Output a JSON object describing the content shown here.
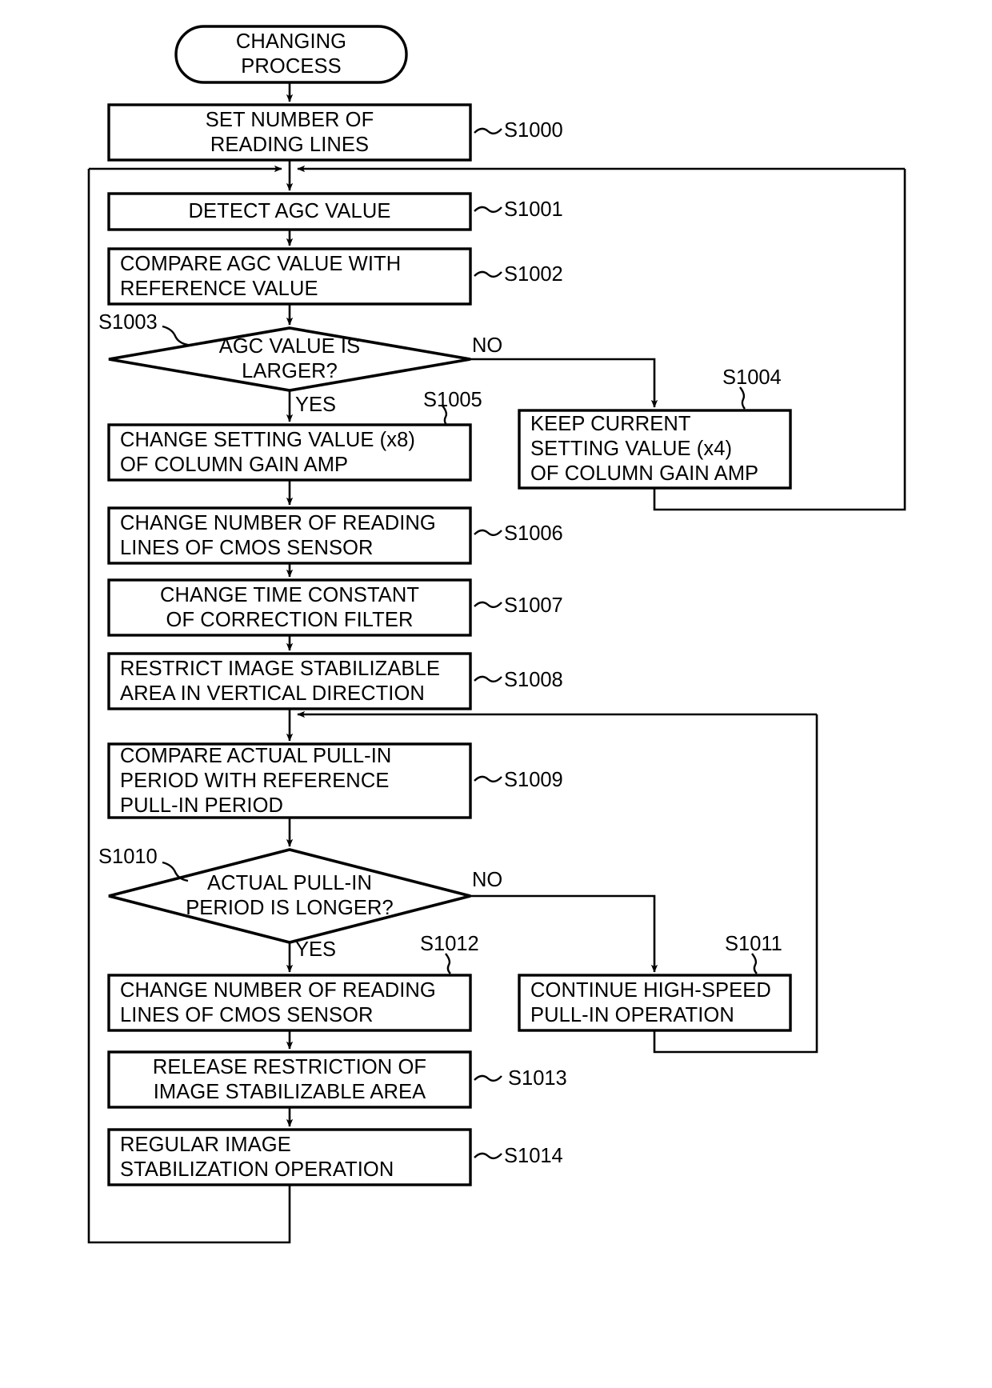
{
  "diagram": {
    "type": "flowchart",
    "title": "CHANGING PROCESS",
    "terminal": {
      "name": "start-terminal",
      "line1": "CHANGING",
      "line2": "PROCESS"
    },
    "nodes": [
      {
        "id": "S1000",
        "shape": "process",
        "tag": "S1000",
        "align": "center",
        "line1": "SET NUMBER OF",
        "line2": "READING LINES",
        "line3": ""
      },
      {
        "id": "S1001",
        "shape": "process",
        "tag": "S1001",
        "align": "center",
        "line1": "DETECT AGC VALUE",
        "line2": "",
        "line3": ""
      },
      {
        "id": "S1002",
        "shape": "process",
        "tag": "S1002",
        "align": "left",
        "line1": "COMPARE AGC VALUE WITH",
        "line2": "REFERENCE VALUE",
        "line3": ""
      },
      {
        "id": "S1003",
        "shape": "decision",
        "tag": "S1003",
        "align": "center",
        "line1": "AGC VALUE IS",
        "line2": "LARGER?",
        "line3": ""
      },
      {
        "id": "S1004",
        "shape": "process",
        "tag": "S1004",
        "align": "left",
        "line1": "KEEP CURRENT",
        "line2": "SETTING VALUE (x4)",
        "line3": "OF COLUMN GAIN AMP"
      },
      {
        "id": "S1005",
        "shape": "process",
        "tag": "S1005",
        "align": "left",
        "line1": "CHANGE SETTING VALUE (x8)",
        "line2": "OF COLUMN GAIN AMP",
        "line3": ""
      },
      {
        "id": "S1006",
        "shape": "process",
        "tag": "S1006",
        "align": "left",
        "line1": "CHANGE NUMBER OF READING",
        "line2": "LINES OF CMOS SENSOR",
        "line3": ""
      },
      {
        "id": "S1007",
        "shape": "process",
        "tag": "S1007",
        "align": "center",
        "line1": "CHANGE TIME CONSTANT",
        "line2": "OF CORRECTION FILTER",
        "line3": ""
      },
      {
        "id": "S1008",
        "shape": "process",
        "tag": "S1008",
        "align": "left",
        "line1": "RESTRICT IMAGE STABILIZABLE",
        "line2": "AREA IN VERTICAL DIRECTION",
        "line3": ""
      },
      {
        "id": "S1009",
        "shape": "process",
        "tag": "S1009",
        "align": "left",
        "line1": "COMPARE ACTUAL PULL-IN",
        "line2": "PERIOD WITH REFERENCE",
        "line3": "PULL-IN PERIOD"
      },
      {
        "id": "S1010",
        "shape": "decision",
        "tag": "S1010",
        "align": "center",
        "line1": "ACTUAL PULL-IN",
        "line2": "PERIOD IS LONGER?",
        "line3": ""
      },
      {
        "id": "S1011",
        "shape": "process",
        "tag": "S1011",
        "align": "left",
        "line1": "CONTINUE HIGH-SPEED",
        "line2": "PULL-IN OPERATION",
        "line3": ""
      },
      {
        "id": "S1012",
        "shape": "process",
        "tag": "S1012",
        "align": "left",
        "line1": "CHANGE NUMBER OF READING",
        "line2": "LINES OF CMOS SENSOR",
        "line3": ""
      },
      {
        "id": "S1013",
        "shape": "process",
        "tag": "S1013",
        "align": "center",
        "line1": "RELEASE RESTRICTION OF",
        "line2": "IMAGE STABILIZABLE AREA",
        "line3": ""
      },
      {
        "id": "S1014",
        "shape": "process",
        "tag": "S1014",
        "align": "left",
        "line1": "REGULAR IMAGE",
        "line2": "STABILIZATION OPERATION",
        "line3": ""
      }
    ],
    "branch_labels": {
      "s1003_no": "NO",
      "s1003_yes": "YES",
      "s1010_no": "NO",
      "s1010_yes": "YES"
    },
    "colors": {
      "stroke": "#000000",
      "fill": "#ffffff",
      "text": "#000000"
    }
  }
}
